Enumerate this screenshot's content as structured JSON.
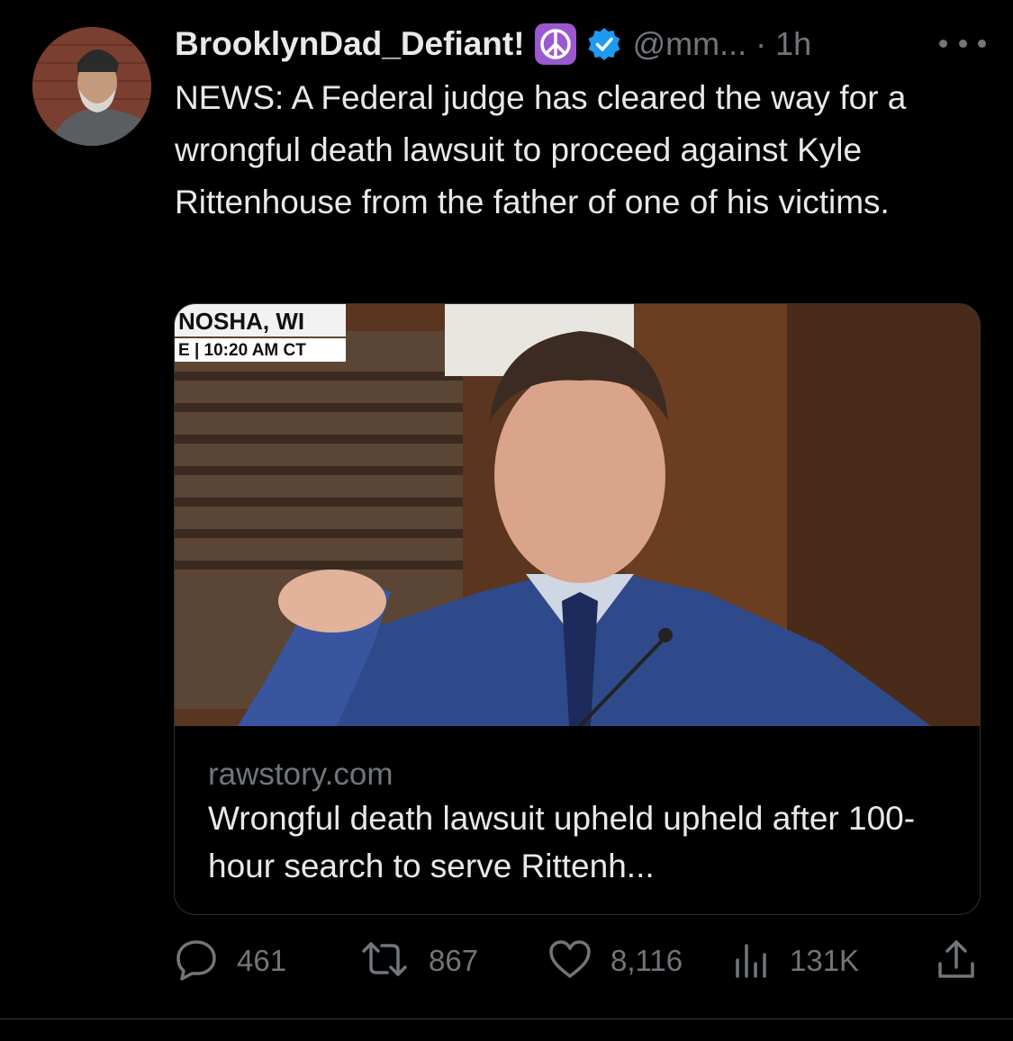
{
  "tweet": {
    "display_name": "BrooklynDad_Defiant!",
    "handle": "@mm...",
    "separator": "·",
    "time": "1h",
    "text": "NEWS: A Federal judge has cleared the way for a wrongful death lawsuit to proceed against Kyle Rittenhouse from the father of one of his victims."
  },
  "card": {
    "chyron_location": "NOSHA, WI",
    "chyron_time": "E | 10:20 AM CT",
    "domain": "rawstory.com",
    "headline": "Wrongful death lawsuit upheld upheld after 100-hour search to serve Rittenh..."
  },
  "actions": {
    "replies": "461",
    "retweets": "867",
    "likes": "8,116",
    "views": "131K"
  },
  "colors": {
    "background": "#000000",
    "text": "#e7e9ea",
    "secondary": "#71767b",
    "verified": "#1d9bf0",
    "peace_badge": "#9b59d0"
  },
  "icons": [
    "more-icon",
    "peace-icon",
    "verified-icon",
    "reply-icon",
    "retweet-icon",
    "like-icon",
    "views-icon",
    "share-icon"
  ]
}
